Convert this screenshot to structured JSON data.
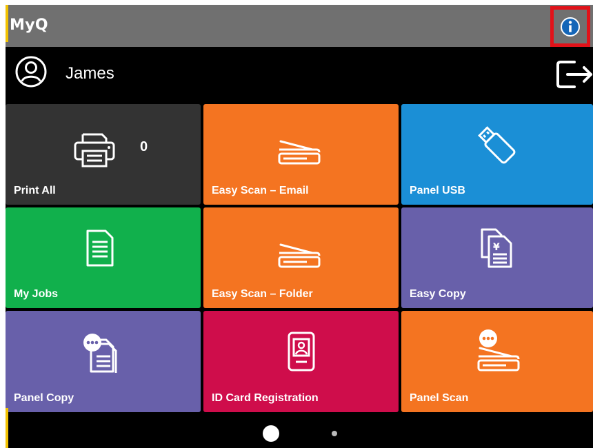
{
  "header": {
    "brand": "MyQ"
  },
  "user": {
    "name": "James"
  },
  "tiles": [
    {
      "label": "Print All",
      "count": "0",
      "color": "#333333"
    },
    {
      "label": "Easy Scan – Email",
      "color": "#f47421"
    },
    {
      "label": "Panel USB",
      "color": "#1b8fd6"
    },
    {
      "label": "My Jobs",
      "color": "#11b04c"
    },
    {
      "label": "Easy Scan – Folder",
      "color": "#f47421"
    },
    {
      "label": "Easy Copy",
      "color": "#6860aa"
    },
    {
      "label": "Panel Copy",
      "color": "#6860aa"
    },
    {
      "label": "ID Card Registration",
      "color": "#cf0d4b"
    },
    {
      "label": "Panel Scan",
      "color": "#f47421"
    }
  ],
  "pager": {
    "pages": 2,
    "current": 1
  },
  "colors": {
    "titlebar": "#707070",
    "highlight": "#e11219",
    "background": "#000000"
  },
  "icons": [
    "info-icon",
    "user-icon",
    "logout-icon",
    "printer-icon",
    "scanner-icon",
    "usb-icon",
    "document-icon",
    "copy-icon",
    "id-card-icon"
  ]
}
